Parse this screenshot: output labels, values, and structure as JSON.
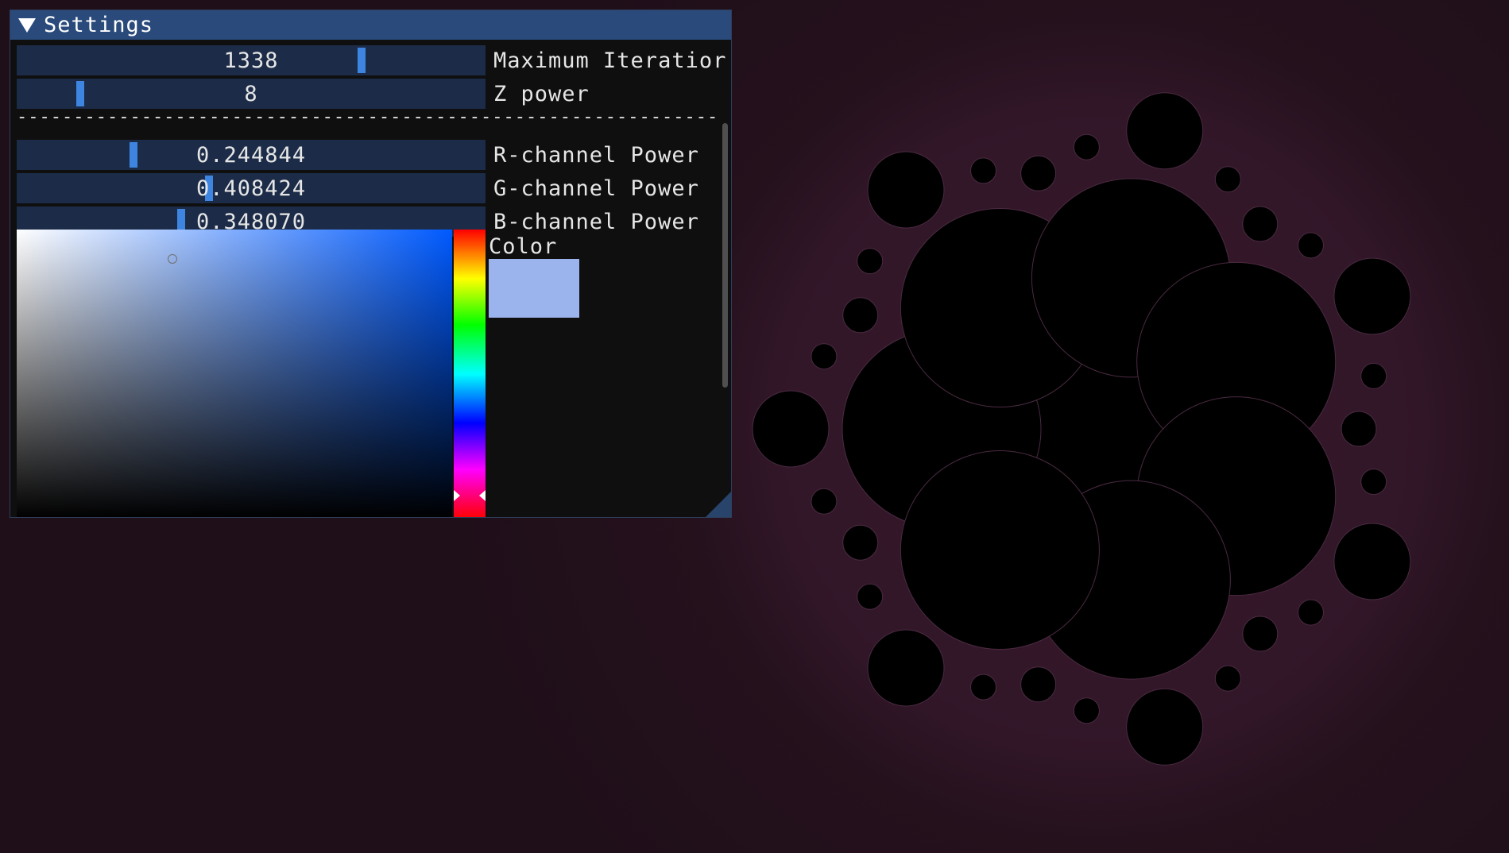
{
  "window": {
    "title": "Settings",
    "sliders": [
      {
        "value": "1338",
        "label": "Maximum Iteratior",
        "fraction": 0.74
      },
      {
        "value": "8",
        "label": "Z power",
        "fraction": 0.13
      }
    ],
    "separator": "--------------------------------------------------------------------------------------",
    "channel_sliders": [
      {
        "value": "0.244844",
        "label": "R-channel Power",
        "fraction": 0.2448
      },
      {
        "value": "0.408424",
        "label": "G-channel Power",
        "fraction": 0.4084
      },
      {
        "value": "0.348070",
        "label": "B-channel Power",
        "fraction": 0.3481
      }
    ],
    "color_picker": {
      "label": "Color",
      "color": "#9bb4ee",
      "hue_color": "#005aff",
      "hue_fraction": 0.92
    }
  },
  "background": {
    "color": "#1f0f19",
    "fractal_color": "#000000"
  },
  "icons": {
    "collapse": "triangle-down-icon",
    "resize": "resize-grip-icon"
  }
}
